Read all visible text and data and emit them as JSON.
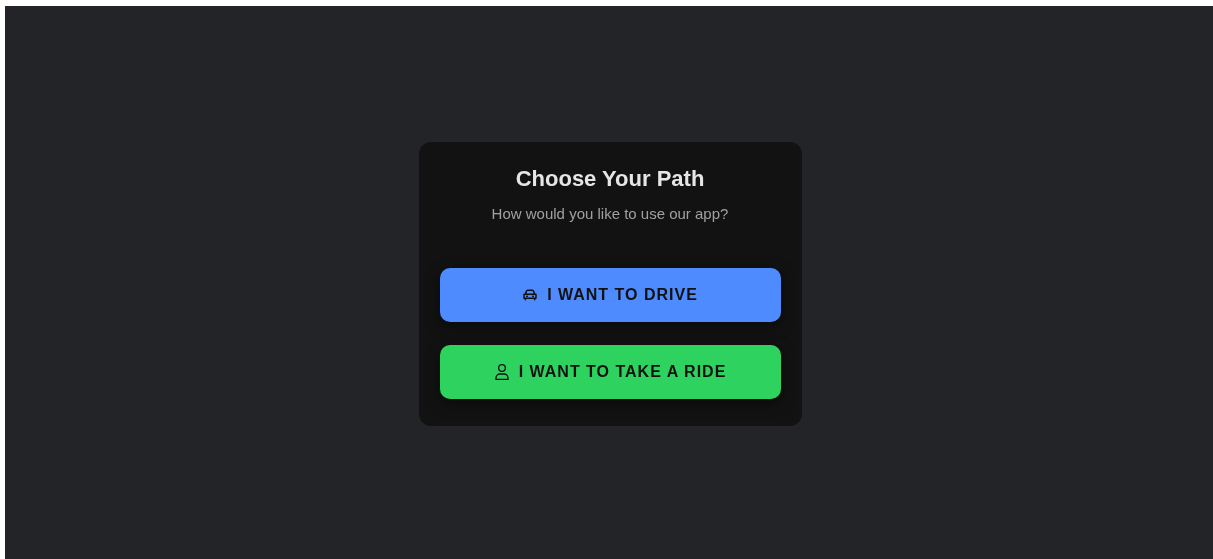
{
  "card": {
    "title": "Choose Your Path",
    "subtitle": "How would you like to use our app?"
  },
  "buttons": [
    {
      "label": "I WANT TO DRIVE",
      "kind": "car",
      "color": "#4d8bff"
    },
    {
      "label": "I WANT TO TAKE A RIDE",
      "kind": "person",
      "color": "#2ed35f"
    }
  ]
}
